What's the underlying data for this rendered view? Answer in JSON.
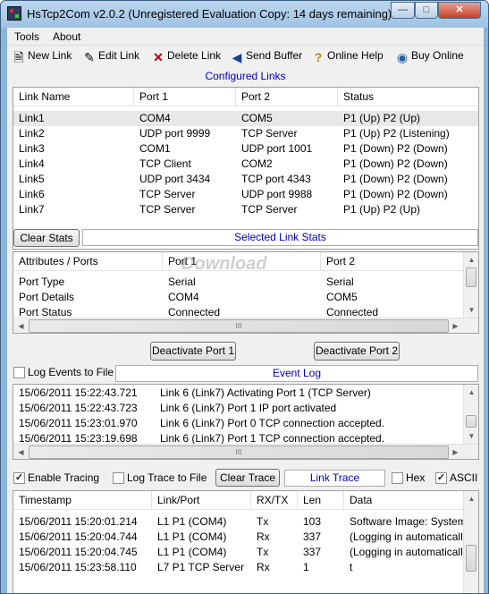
{
  "window": {
    "title": "HsTcp2Com v2.0.2 (Unregistered Evaluation Copy: 14 days remaining)"
  },
  "menu": {
    "tools": "Tools",
    "about": "About"
  },
  "toolbar": {
    "new_link": "New Link",
    "edit_link": "Edit Link",
    "delete_link": "Delete Link",
    "send_buffer": "Send Buffer",
    "online_help": "Online Help",
    "buy_online": "Buy Online"
  },
  "links": {
    "title": "Configured Links",
    "headers": [
      "Link Name",
      "Port 1",
      "Port 2",
      "Status"
    ],
    "rows": [
      [
        "Link1",
        "COM4",
        "COM5",
        "P1 (Up) P2 (Up)"
      ],
      [
        "Link2",
        "UDP port 9999",
        "TCP Server",
        "P1 (Up) P2 (Listening)"
      ],
      [
        "Link3",
        "COM1",
        "UDP port 1001",
        "P1 (Down) P2 (Down)"
      ],
      [
        "Link4",
        "TCP Client",
        "COM2",
        "P1 (Down) P2 (Down)"
      ],
      [
        "Link5",
        "UDP port 3434",
        "TCP port 4343",
        "P1 (Down) P2 (Down)"
      ],
      [
        "Link6",
        "TCP Server",
        "UDP port 9988",
        "P1 (Down) P2 (Down)"
      ],
      [
        "Link7",
        "TCP Server",
        "TCP Server",
        "P1 (Up) P2 (Up)"
      ]
    ]
  },
  "stats": {
    "clear_label": "Clear Stats",
    "title": "Selected Link Stats",
    "headers": [
      "Attributes / Ports",
      "Port 1",
      "Port 2"
    ],
    "rows": [
      [
        "Port Type",
        "Serial",
        "Serial"
      ],
      [
        "Port Details",
        "COM4",
        "COM5"
      ],
      [
        "Port Status",
        "Connected",
        "Connected"
      ]
    ]
  },
  "ports": {
    "deactivate1": "Deactivate Port 1",
    "deactivate2": "Deactivate Port 2"
  },
  "eventlog": {
    "log_to_file": "Log Events to File",
    "log_to_file_checked": false,
    "title": "Event Log",
    "rows": [
      [
        "15/06/2011 15:22:43.721",
        "Link 6 (Link7) Activating Port 1 (TCP Server)"
      ],
      [
        "15/06/2011 15:22:43.723",
        "Link 6 (Link7) Port 1 IP port activated"
      ],
      [
        "15/06/2011 15:23:01.970",
        "Link 6 (Link7) Port 0 TCP connection accepted."
      ],
      [
        "15/06/2011 15:23:19.698",
        "Link 6 (Link7) Port 1 TCP connection accepted."
      ]
    ]
  },
  "trace": {
    "enable_tracing": "Enable Tracing",
    "enable_tracing_checked": true,
    "log_trace_to_file": "Log Trace to File",
    "log_trace_to_file_checked": false,
    "clear_trace": "Clear Trace",
    "title": "Link Trace",
    "hex": "Hex",
    "hex_checked": false,
    "ascii": "ASCII",
    "ascii_checked": true,
    "headers": [
      "Timestamp",
      "Link/Port",
      "RX/TX",
      "Len",
      "Data"
    ],
    "rows": [
      [
        "15/06/2011 15:20:01.214",
        "L1 P1 (COM4)",
        "Tx",
        "103",
        "Software Image: System (E."
      ],
      [
        "15/06/2011 15:20:04.744",
        "L1 P1 (COM4)",
        "Rx",
        "337",
        "(Logging in automatically us"
      ],
      [
        "15/06/2011 15:20:04.745",
        "L1 P1 (COM4)",
        "Tx",
        "337",
        "(Logging in automatically us"
      ],
      [
        "15/06/2011 15:23:58.110",
        "L7 P1 TCP Server",
        "Rx",
        "1",
        "t"
      ]
    ]
  },
  "watermark": "Download",
  "scroll": {
    "thumb_grip": "III"
  }
}
